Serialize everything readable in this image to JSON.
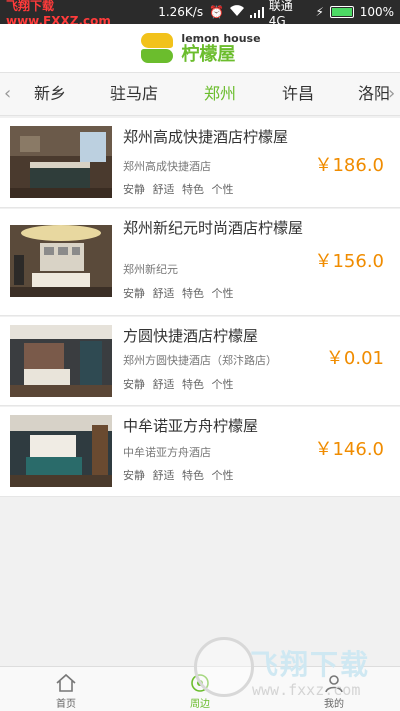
{
  "status_bar": {
    "watermark": "飞翔下载 www.FXXZ.com",
    "speed": "1.26K/s",
    "carrier": "联通 4G",
    "battery": "100%"
  },
  "header": {
    "logo_en": "lemon house",
    "logo_cn": "柠檬屋"
  },
  "tabs": [
    {
      "label": "新乡"
    },
    {
      "label": "驻马店"
    },
    {
      "label": "郑州"
    },
    {
      "label": "许昌"
    },
    {
      "label": "洛阳"
    }
  ],
  "hotels": [
    {
      "name": "郑州高成快捷酒店柠檬屋",
      "subtitle": "郑州高成快捷酒店",
      "tags": "安静 舒适 特色 个性",
      "price": "￥186.0"
    },
    {
      "name": "郑州新纪元时尚酒店柠檬屋",
      "subtitle": "郑州新纪元",
      "tags": "安静 舒适 特色 个性",
      "price": "￥156.0"
    },
    {
      "name": "方圆快捷酒店柠檬屋",
      "subtitle": "郑州方圆快捷酒店（郑汴路店）",
      "tags": "安静 舒适 特色 个性",
      "price": "￥0.01"
    },
    {
      "name": "中牟诺亚方舟柠檬屋",
      "subtitle": "中牟诺亚方舟酒店",
      "tags": "安静 舒适 特色 个性",
      "price": "￥146.0"
    }
  ],
  "tabbar": {
    "home": "首页",
    "nearby": "周边",
    "mine": "我的"
  },
  "bottom_watermark": {
    "cn": "飞翔下载",
    "url": "www.fxxz.com"
  },
  "colors": {
    "accent": "#6bbd2d",
    "price": "#f08c00",
    "status_bg": "#2b2b2b"
  }
}
